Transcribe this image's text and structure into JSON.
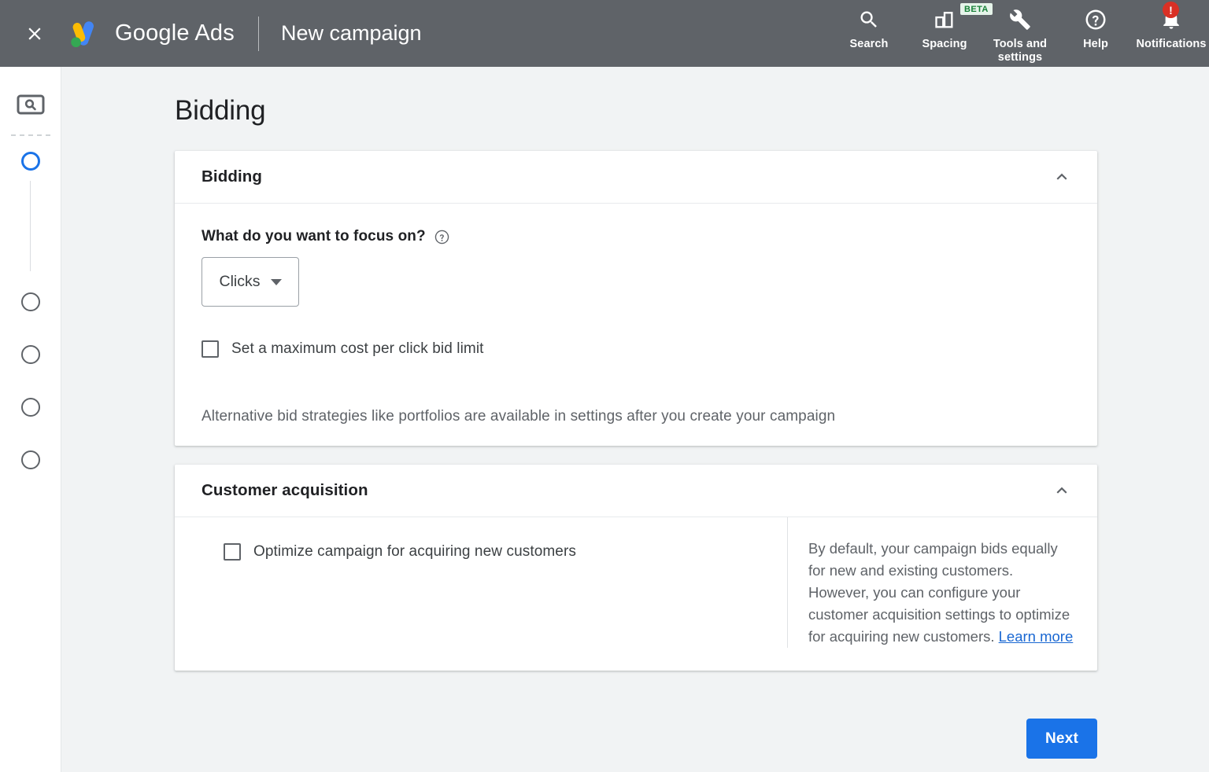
{
  "topbar": {
    "close_icon": "close-icon",
    "logo_icon": "google-ads-logo",
    "brand": "Google Ads",
    "page_subtitle": "New campaign",
    "actions": [
      {
        "label": "Search",
        "icon": "search-icon",
        "badge": null
      },
      {
        "label": "Spacing",
        "icon": "spacing-icon",
        "badge": "BETA"
      },
      {
        "label": "Tools and settings",
        "icon": "wrench-icon",
        "badge": null
      },
      {
        "label": "Help",
        "icon": "help-circle-icon",
        "badge": null
      },
      {
        "label": "Notifications",
        "icon": "bell-icon",
        "badge": "!"
      }
    ]
  },
  "sidebar": {
    "campaign_type_icon": "search-campaign-icon",
    "steps": [
      {
        "name": "step-1",
        "state": "active"
      },
      {
        "name": "step-2",
        "state": "inactive"
      },
      {
        "name": "step-3",
        "state": "inactive"
      },
      {
        "name": "step-4",
        "state": "inactive"
      },
      {
        "name": "step-5",
        "state": "inactive"
      }
    ]
  },
  "page": {
    "title": "Bidding"
  },
  "bidding_card": {
    "title": "Bidding",
    "collapse_icon": "chevron-up-icon",
    "focus_question": "What do you want to focus on?",
    "focus_help_icon": "help-circle-icon",
    "focus_value": "Clicks",
    "max_cpc_checkbox_label": "Set a maximum cost per click bid limit",
    "max_cpc_checked": false,
    "note": "Alternative bid strategies like portfolios are available in settings after you create your campaign"
  },
  "acquisition_card": {
    "title": "Customer acquisition",
    "collapse_icon": "chevron-up-icon",
    "optimize_checkbox_label": "Optimize campaign for acquiring new customers",
    "optimize_checked": false,
    "info_text": "By default, your campaign bids equally for new and existing customers. However, you can configure your customer acquisition settings to optimize for acquiring new customers. ",
    "info_link": "Learn more"
  },
  "footer": {
    "next_label": "Next"
  },
  "colors": {
    "topbar_bg": "#5f6368",
    "page_bg": "#f1f3f4",
    "accent_blue": "#1a73e8",
    "link_blue": "#1967d2",
    "badge_red": "#d93025",
    "beta_green_bg": "#e6f4ea",
    "beta_green_text": "#188038"
  }
}
